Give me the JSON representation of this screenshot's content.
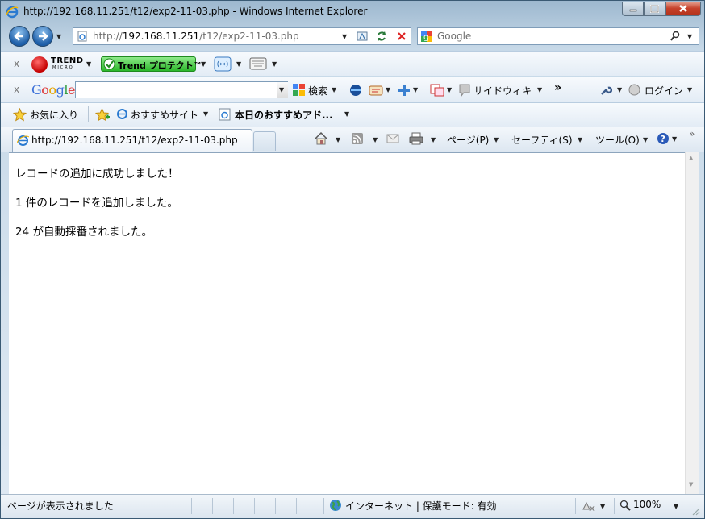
{
  "window": {
    "title": "http://192.168.11.251/t12/exp2-11-03.php - Windows Internet Explorer"
  },
  "address": {
    "prefix": "http://",
    "host": "192.168.11.251",
    "path": "/t12/exp2-11-03.php"
  },
  "search": {
    "placeholder": "Google"
  },
  "trend_toolbar": {
    "logo_top": "TREND",
    "logo_bottom": "MICRO",
    "protect_label": "Trend プロテクト™"
  },
  "google_toolbar": {
    "logo": "Google",
    "search_value": "",
    "search_button": "検索",
    "sidewiki": "サイドウィキ",
    "more": "»",
    "login": "ログイン"
  },
  "favorites_bar": {
    "favorites": "お気に入り",
    "suggested": "おすすめサイト",
    "recommended": "本日のおすすめアド..."
  },
  "tabs": [
    {
      "label": "http://192.168.11.251/t12/exp2-11-03.php"
    }
  ],
  "command_bar": {
    "page": "ページ(P)",
    "safety": "セーフティ(S)",
    "tools": "ツール(O)",
    "more": "»"
  },
  "content": {
    "lines": [
      "レコードの追加に成功しました！",
      "1 件のレコードを追加しました。",
      "24 が自動採番されました。"
    ]
  },
  "status": {
    "text": "ページが表示されました",
    "zone": "インターネット | 保護モード: 有効",
    "zoom": "100%"
  },
  "colors": {
    "ie_blue": "#1d5ea8",
    "close_red": "#c6412a",
    "trend_green": "#2bb72a"
  }
}
